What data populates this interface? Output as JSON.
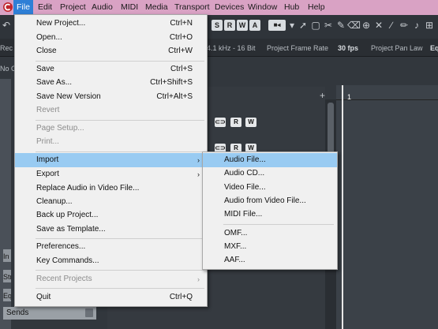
{
  "menubar": {
    "items": [
      "File",
      "Edit",
      "Project",
      "Audio",
      "MIDI",
      "Media",
      "Transport",
      "Devices",
      "Window",
      "Hub",
      "Help"
    ],
    "active": "File"
  },
  "toolbar": {
    "mode_buttons": [
      "S",
      "R",
      "W",
      "A"
    ],
    "tool_icons": [
      "pointer-icon",
      "range-icon",
      "split-icon",
      "glue-icon",
      "erase-icon",
      "zoom-icon",
      "mute-icon",
      "mute-x-icon",
      "draw-line-icon",
      "time-warp-icon",
      "comp-icon",
      "more-icon"
    ]
  },
  "statusbar": {
    "left_fragment": "Rec",
    "sample_rate": "4.1 kHz - 16 Bit",
    "frame_rate_label": "Project Frame Rate",
    "frame_rate_value": "30 fps",
    "pan_law_label": "Project Pan Law",
    "right_fragment": "Eq",
    "no_object": "No O"
  },
  "left_panel": {
    "tabs": [
      "In",
      "Str",
      "Eq"
    ],
    "sends_label": "Sends"
  },
  "timeline": {
    "first_bar": "1"
  },
  "file_menu": {
    "items": [
      {
        "label": "New Project...",
        "shortcut": "Ctrl+N",
        "disabled": false
      },
      {
        "label": "Open...",
        "shortcut": "Ctrl+O",
        "disabled": false
      },
      {
        "label": "Close",
        "shortcut": "Ctrl+W",
        "disabled": false
      },
      {
        "label": "Save",
        "shortcut": "Ctrl+S",
        "disabled": false
      },
      {
        "label": "Save As...",
        "shortcut": "Ctrl+Shift+S",
        "disabled": false
      },
      {
        "label": "Save New Version",
        "shortcut": "Ctrl+Alt+S",
        "disabled": false
      },
      {
        "label": "Revert",
        "shortcut": "",
        "disabled": true
      },
      {
        "label": "Page Setup...",
        "shortcut": "",
        "disabled": true
      },
      {
        "label": "Print...",
        "shortcut": "",
        "disabled": true
      },
      {
        "label": "Import",
        "shortcut": "",
        "disabled": false,
        "submenu": true,
        "highlighted": true
      },
      {
        "label": "Export",
        "shortcut": "",
        "disabled": false,
        "submenu": true
      },
      {
        "label": "Replace Audio in Video File...",
        "shortcut": "",
        "disabled": false
      },
      {
        "label": "Cleanup...",
        "shortcut": "",
        "disabled": false
      },
      {
        "label": "Back up Project...",
        "shortcut": "",
        "disabled": false
      },
      {
        "label": "Save as Template...",
        "shortcut": "",
        "disabled": false
      },
      {
        "label": "Preferences...",
        "shortcut": "",
        "disabled": false
      },
      {
        "label": "Key Commands...",
        "shortcut": "",
        "disabled": false
      },
      {
        "label": "Recent Projects",
        "shortcut": "",
        "disabled": true,
        "submenu": true
      },
      {
        "label": "Quit",
        "shortcut": "Ctrl+Q",
        "disabled": false
      }
    ]
  },
  "import_menu": {
    "items": [
      {
        "label": "Audio File...",
        "highlighted": true
      },
      {
        "label": "Audio CD..."
      },
      {
        "label": "Video File..."
      },
      {
        "label": "Audio from Video File..."
      },
      {
        "label": "MIDI File..."
      },
      {
        "label": "OMF..."
      },
      {
        "label": "MXF..."
      },
      {
        "label": "AAF..."
      }
    ]
  },
  "colors": {
    "menubar": "#d9a2c4",
    "highlight_menubar": "#2e7fd6",
    "menu_highlight": "#99cbf2",
    "menu_bg": "#f0f0f0"
  }
}
